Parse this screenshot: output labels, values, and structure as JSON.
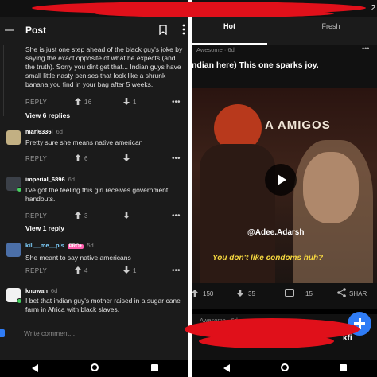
{
  "left": {
    "header": {
      "title": "Post"
    },
    "comments": [
      {
        "body": "She is just one step ahead of the black guy's joke by saying the exact opposite of what he expects (and the truth). Sorry you dint get that... Indian guys have small little nasty penises that look like a shrunk banana you find in your bag after 5 weeks.",
        "reply_label": "REPLY",
        "upvotes": "16",
        "downvotes": "1",
        "more": "View 6 replies"
      },
      {
        "author": "mari6336i",
        "age": "6d",
        "body": "Pretty sure she means native american",
        "reply_label": "REPLY",
        "upvotes": "6"
      },
      {
        "author": "imperial_6896",
        "age": "6d",
        "body": "I've got the feeling this girl receives government handouts.",
        "reply_label": "REPLY",
        "upvotes": "3",
        "more": "View 1 reply"
      },
      {
        "author": "kill__me__pls",
        "badge": "PRO+",
        "age": "5d",
        "body": "She meant to say native americans",
        "reply_label": "REPLY",
        "upvotes": "4",
        "downvotes": "1"
      },
      {
        "author": "knuwan",
        "age": "6d",
        "body": "I bet that indian guy's mother raised in a sugar cane farm in Africa with black slaves."
      }
    ],
    "comment_input": {
      "placeholder": "Write comment..."
    }
  },
  "right": {
    "tabs": [
      {
        "label": "Hot"
      },
      {
        "label": "Fresh"
      }
    ],
    "post1": {
      "meta": "Awesome · 6d",
      "title": "ndian here) This one sparks joy.",
      "video_sign": "A AMIGOS",
      "video_watermark": "@Adee.Adarsh",
      "video_caption": "You don't like condoms huh?",
      "upvotes": "150",
      "downvotes": "35",
      "comments": "15",
      "share": "SHAR"
    },
    "post2": {
      "meta": "Awesome · 6d",
      "title_fragment": "kfi"
    },
    "status_fragment": "2"
  },
  "colors": {
    "accent": "#2f7cf6",
    "scribble": "#e0101a",
    "upvote": "#cfcfcf",
    "online": "#46d160"
  },
  "icons": [
    "menu-icon",
    "bookmark-icon",
    "more-vert-icon",
    "upvote-icon",
    "downvote-icon",
    "more-horiz-icon",
    "play-icon",
    "comment-icon",
    "share-icon",
    "plus-icon",
    "back-icon",
    "home-icon",
    "recents-icon"
  ]
}
